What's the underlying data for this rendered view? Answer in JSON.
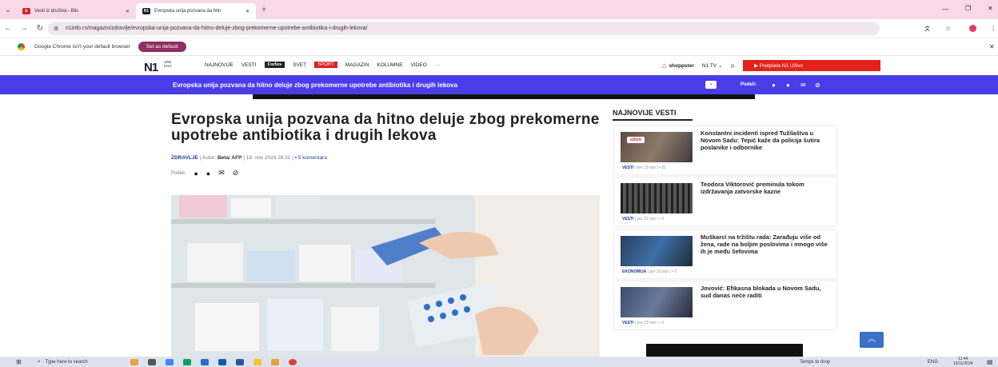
{
  "browser": {
    "tabs": [
      {
        "title": "Vesti iz društva - Blic",
        "icon": "blic-favicon"
      },
      {
        "title": "Evropska unija pozvana da hitn",
        "icon": "n1-favicon"
      }
    ],
    "url": "n1info.rs/magazin/zdravlje/evropska-unija-pozvana-da-hitno-deluje-zbog-prekomerne-upotrebe-antibiotika-i-drugih-lekova/",
    "default_msg": "Google Chrome isn't your default browser",
    "set_default": "Set as default"
  },
  "site": {
    "logo": "N1",
    "lang_top": "SRB",
    "lang_bottom": "ENG",
    "nav": [
      "NAJNOVIJE",
      "VESTI",
      "Forbes",
      "SVET",
      "SPORT",
      "MAGAZIN",
      "KOLUMNE",
      "VIDEO",
      "···"
    ],
    "shoppster": "shoppster",
    "n1tv": "N1 TV",
    "pretplata": "Pretplata N1 Uživo",
    "bluebar_title": "Evropska unija pozvana da hitno deluje zbog prekomerne upotrebe antibiotika i drugih lekova",
    "podeli": "Podeli:"
  },
  "article": {
    "headline": "Evropska unija pozvana da hitno deluje zbog prekomerne upotrebe antibiotika i drugih lekova",
    "category": "ZDRAVLJE",
    "author_label": "Autor:",
    "author": "Beta/ AFP",
    "date": "18. nov 2024 16:31",
    "comments": "5 komentara",
    "share_label": "Podeli:"
  },
  "sidebar": {
    "title": "NAJNOVIJE VESTI",
    "items": [
      {
        "title": "Konstantni incidenti ispred Tužilaštva u Novom Sadu: Tepić kaže da policija šutira poslanike i odbornike",
        "category": "VESTI",
        "time": "pre 19 min",
        "comments": "81",
        "badge": "uživo"
      },
      {
        "title": "Teodora Viktorović preminula tokom izdržavanja zatvorske kazne",
        "category": "VESTI",
        "time": "pre 22 min",
        "comments": "0"
      },
      {
        "title": "Muškarci na tržištu rada: Zarađuju više od žena, rade na boljim poslovima i mnogo više ih je među šefovima",
        "category": "EKONOMIJA",
        "time": "pre 23 min",
        "comments": "0"
      },
      {
        "title": "Jovović: Efikasna blokada u Novom Sadu, sud danas neće raditi",
        "category": "VESTI",
        "time": "pre 23 min",
        "comments": "0"
      }
    ]
  },
  "taskbar": {
    "search": "Type here to search",
    "drop": "Temps to drop",
    "lang": "ENG",
    "time": "11:44",
    "date": "19/11/2024"
  }
}
